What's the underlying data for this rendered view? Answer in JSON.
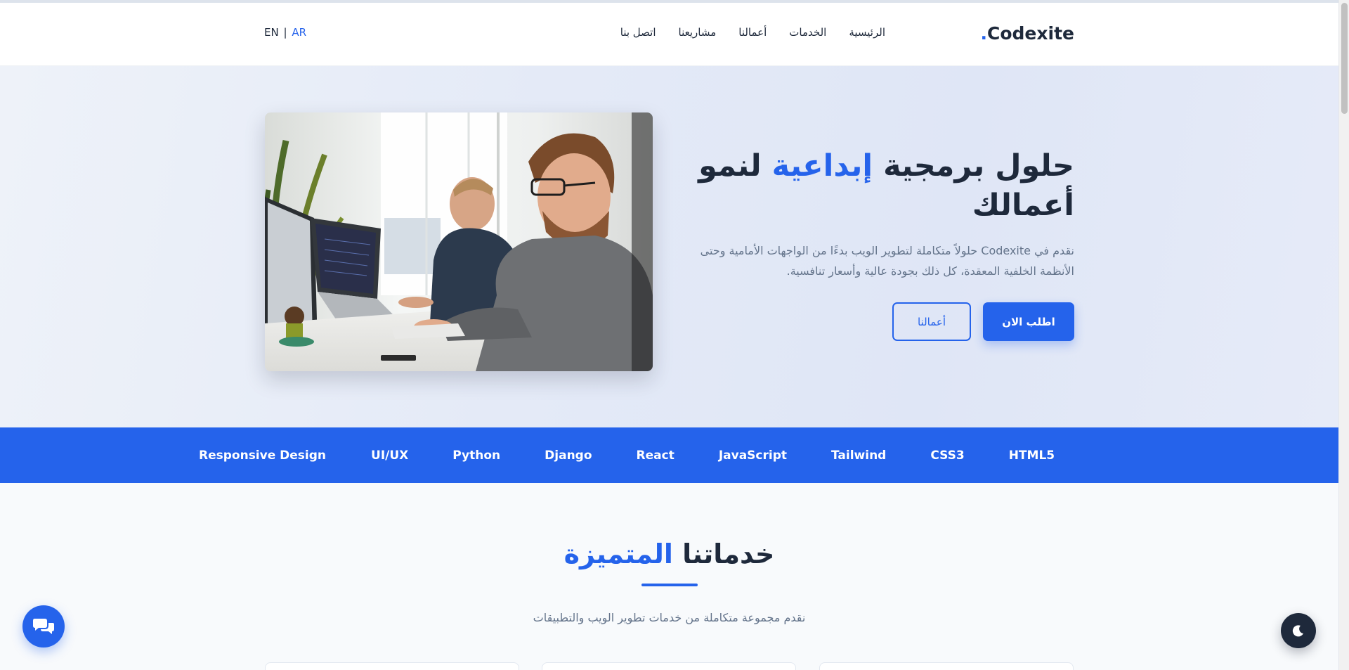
{
  "header": {
    "logo": "Codexite",
    "logo_dot": ".",
    "nav": [
      "الرئيسية",
      "الخدمات",
      "أعمالنا",
      "مشاريعنا",
      "اتصل بنا"
    ],
    "lang_en": "EN",
    "lang_sep": "|",
    "lang_ar": "AR"
  },
  "hero": {
    "title_part1": "حلول برمجية ",
    "title_accent": "إبداعية",
    "title_part2": " لنمو أعمالك",
    "description": "نقدم في Codexite حلولاً متكاملة لتطوير الويب بدءًا من الواجهات الأمامية وحتى الأنظمة الخلفية المعقدة، كل ذلك بجودة عالية وأسعار تنافسية.",
    "primary_button": "اطلب الان",
    "secondary_button": "أعمالنا",
    "image_icon": "office-photo"
  },
  "tech": [
    "Responsive Design",
    "UI/UX",
    "Python",
    "Django",
    "React",
    "JavaScript",
    "Tailwind",
    "CSS3",
    "HTML5"
  ],
  "services": {
    "title_main": "خدماتنا ",
    "title_accent": "المتميزة",
    "subtitle": "نقدم مجموعة متكاملة من خدمات تطوير الويب والتطبيقات"
  },
  "floating": {
    "chat_icon": "chat-bubbles-icon",
    "theme_icon": "moon-icon"
  },
  "colors": {
    "accent": "#2563eb",
    "dark": "#1e293b",
    "muted": "#64748b"
  }
}
